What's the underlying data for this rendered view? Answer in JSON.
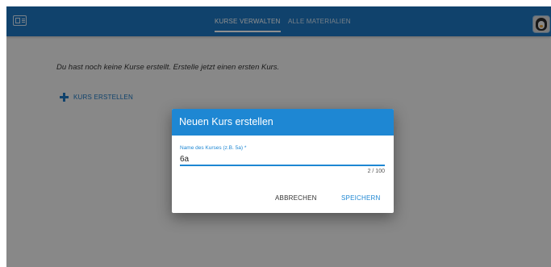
{
  "header": {
    "logo_icon": "id-card-icon",
    "tabs": [
      {
        "label": "KURSE VERWALTEN",
        "active": true
      },
      {
        "label": "ALLE MATERIALIEN",
        "active": false
      }
    ],
    "avatar_icon": "penguin-avatar-icon"
  },
  "main": {
    "empty_message": "Du hast noch keine Kurse erstellt. Erstelle jetzt einen ersten Kurs.",
    "create_label": "KURS ERSTELLEN",
    "create_icon": "plus-icon"
  },
  "dialog": {
    "title": "Neuen Kurs erstellen",
    "field_label": "Name des Kurses (z.B. 5a) *",
    "field_value": "6a",
    "counter": "2 / 100",
    "cancel_label": "ABBRECHEN",
    "save_label": "SPEICHERN"
  },
  "colors": {
    "primary": "#1e77c0",
    "dialog_header": "#1e87d3",
    "background": "#f3f3f3"
  }
}
